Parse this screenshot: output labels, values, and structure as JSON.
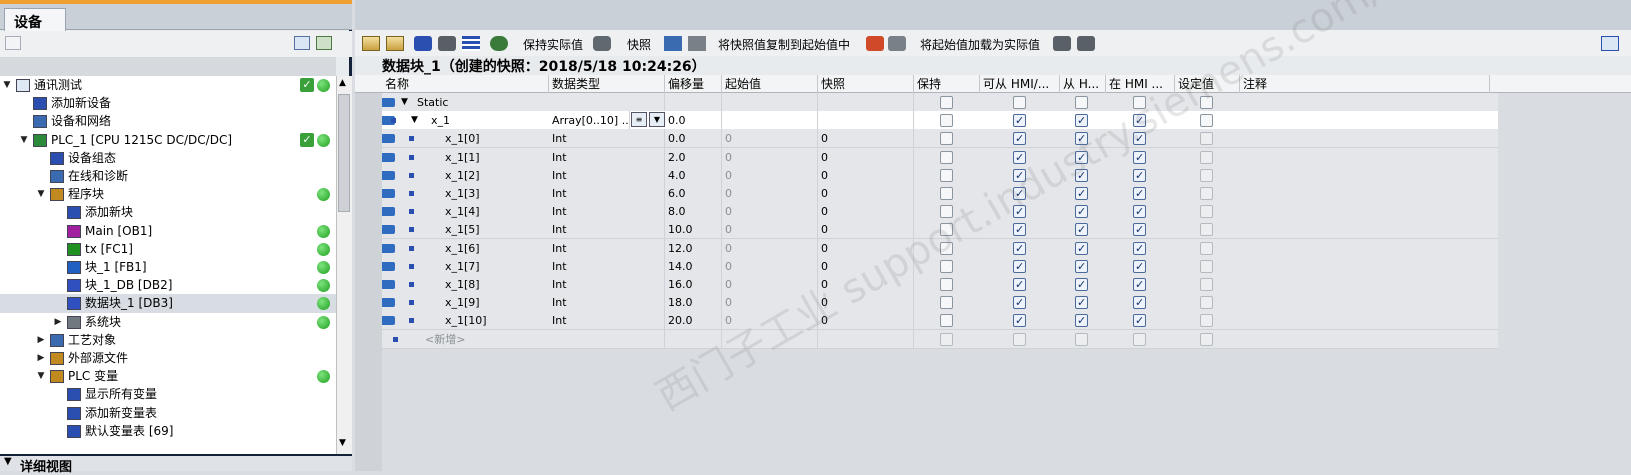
{
  "left": {
    "tab_label": "设备",
    "detail_view": "详细视图",
    "tree": [
      {
        "label": "通讯测试",
        "level": 0,
        "expand": "open",
        "check": true,
        "dot": true
      },
      {
        "label": "添加新设备",
        "level": 1,
        "expand": "none",
        "check": false,
        "dot": false
      },
      {
        "label": "设备和网络",
        "level": 1,
        "expand": "none",
        "check": false,
        "dot": false
      },
      {
        "label": "PLC_1 [CPU 1215C DC/DC/DC]",
        "level": 1,
        "expand": "open",
        "check": true,
        "dot": true
      },
      {
        "label": "设备组态",
        "level": 2,
        "expand": "none",
        "check": false,
        "dot": false
      },
      {
        "label": "在线和诊断",
        "level": 2,
        "expand": "none",
        "check": false,
        "dot": false
      },
      {
        "label": "程序块",
        "level": 2,
        "expand": "open",
        "check": false,
        "dot": true
      },
      {
        "label": "添加新块",
        "level": 3,
        "expand": "none",
        "check": false,
        "dot": false
      },
      {
        "label": "Main [OB1]",
        "level": 3,
        "expand": "none",
        "check": false,
        "dot": true
      },
      {
        "label": "tx [FC1]",
        "level": 3,
        "expand": "none",
        "check": false,
        "dot": true
      },
      {
        "label": "块_1 [FB1]",
        "level": 3,
        "expand": "none",
        "check": false,
        "dot": true
      },
      {
        "label": "块_1_DB [DB2]",
        "level": 3,
        "expand": "none",
        "check": false,
        "dot": true
      },
      {
        "label": "数据块_1 [DB3]",
        "level": 3,
        "expand": "none",
        "check": false,
        "dot": true,
        "selected": true
      },
      {
        "label": "系统块",
        "level": 3,
        "expand": "closed",
        "check": false,
        "dot": true
      },
      {
        "label": "工艺对象",
        "level": 2,
        "expand": "closed",
        "check": false,
        "dot": false
      },
      {
        "label": "外部源文件",
        "level": 2,
        "expand": "closed",
        "check": false,
        "dot": false
      },
      {
        "label": "PLC 变量",
        "level": 2,
        "expand": "open",
        "check": false,
        "dot": true
      },
      {
        "label": "显示所有变量",
        "level": 3,
        "expand": "none",
        "check": false,
        "dot": false
      },
      {
        "label": "添加新变量表",
        "level": 3,
        "expand": "none",
        "check": false,
        "dot": false
      },
      {
        "label": "默认变量表 [69]",
        "level": 3,
        "expand": "none",
        "check": false,
        "dot": false
      }
    ]
  },
  "toolbar": {
    "keep_actual": "保持实际值",
    "snapshot": "快照",
    "copy_snapshot": "将快照值复制到起始值中",
    "load_start": "将起始值加载为实际值"
  },
  "block_title": "数据块_1（创建的快照：2018/5/18 10:24:26）",
  "columns": [
    "名称",
    "数据类型",
    "偏移量",
    "起始值",
    "快照",
    "保持",
    "可从 HMI/...",
    "从 H...",
    "在 HMI ...",
    "设定值",
    "注释"
  ],
  "rows": [
    {
      "num": "1",
      "name": "Static",
      "indent": 0,
      "expand": "open",
      "type": "",
      "offset": "",
      "start": "",
      "snap": "",
      "cb": [
        "off",
        "off",
        "off",
        "off",
        "off"
      ],
      "kind": "static"
    },
    {
      "num": "2",
      "name": "x_1",
      "indent": 1,
      "expand": "open",
      "type": "Array[0..10] ...",
      "offset": "0.0",
      "start": "",
      "snap": "",
      "cb": [
        "off",
        "on",
        "on",
        "on",
        "off"
      ],
      "kind": "array"
    },
    {
      "num": "3",
      "name": "x_1[0]",
      "indent": 2,
      "type": "Int",
      "offset": "0.0",
      "start": "0",
      "snap": "0",
      "cb": [
        "off",
        "on",
        "on",
        "on",
        "dis"
      ]
    },
    {
      "num": "4",
      "name": "x_1[1]",
      "indent": 2,
      "type": "Int",
      "offset": "2.0",
      "start": "0",
      "snap": "0",
      "cb": [
        "off",
        "on",
        "on",
        "on",
        "dis"
      ]
    },
    {
      "num": "5",
      "name": "x_1[2]",
      "indent": 2,
      "type": "Int",
      "offset": "4.0",
      "start": "0",
      "snap": "0",
      "cb": [
        "off",
        "on",
        "on",
        "on",
        "dis"
      ]
    },
    {
      "num": "6",
      "name": "x_1[3]",
      "indent": 2,
      "type": "Int",
      "offset": "6.0",
      "start": "0",
      "snap": "0",
      "cb": [
        "off",
        "on",
        "on",
        "on",
        "dis"
      ]
    },
    {
      "num": "7",
      "name": "x_1[4]",
      "indent": 2,
      "type": "Int",
      "offset": "8.0",
      "start": "0",
      "snap": "0",
      "cb": [
        "off",
        "on",
        "on",
        "on",
        "dis"
      ]
    },
    {
      "num": "8",
      "name": "x_1[5]",
      "indent": 2,
      "type": "Int",
      "offset": "10.0",
      "start": "0",
      "snap": "0",
      "cb": [
        "off",
        "on",
        "on",
        "on",
        "dis"
      ]
    },
    {
      "num": "9",
      "name": "x_1[6]",
      "indent": 2,
      "type": "Int",
      "offset": "12.0",
      "start": "0",
      "snap": "0",
      "cb": [
        "off",
        "on",
        "on",
        "on",
        "dis"
      ]
    },
    {
      "num": "10",
      "name": "x_1[7]",
      "indent": 2,
      "type": "Int",
      "offset": "14.0",
      "start": "0",
      "snap": "0",
      "cb": [
        "off",
        "on",
        "on",
        "on",
        "dis"
      ]
    },
    {
      "num": "11",
      "name": "x_1[8]",
      "indent": 2,
      "type": "Int",
      "offset": "16.0",
      "start": "0",
      "snap": "0",
      "cb": [
        "off",
        "on",
        "on",
        "on",
        "dis"
      ]
    },
    {
      "num": "12",
      "name": "x_1[9]",
      "indent": 2,
      "type": "Int",
      "offset": "18.0",
      "start": "0",
      "snap": "0",
      "cb": [
        "off",
        "on",
        "on",
        "on",
        "dis"
      ]
    },
    {
      "num": "13",
      "name": "x_1[10]",
      "indent": 2,
      "type": "Int",
      "offset": "20.0",
      "start": "0",
      "snap": "0",
      "cb": [
        "off",
        "on",
        "on",
        "on",
        "dis"
      ]
    },
    {
      "num": "14",
      "name": "<新增>",
      "indent": 1,
      "type": "",
      "offset": "",
      "start": "",
      "snap": "",
      "cb": [
        "dis",
        "dis",
        "dis",
        "dis",
        "dis"
      ],
      "kind": "add"
    }
  ],
  "watermark": "西门子工业 support.industry.siemens.com/cs"
}
